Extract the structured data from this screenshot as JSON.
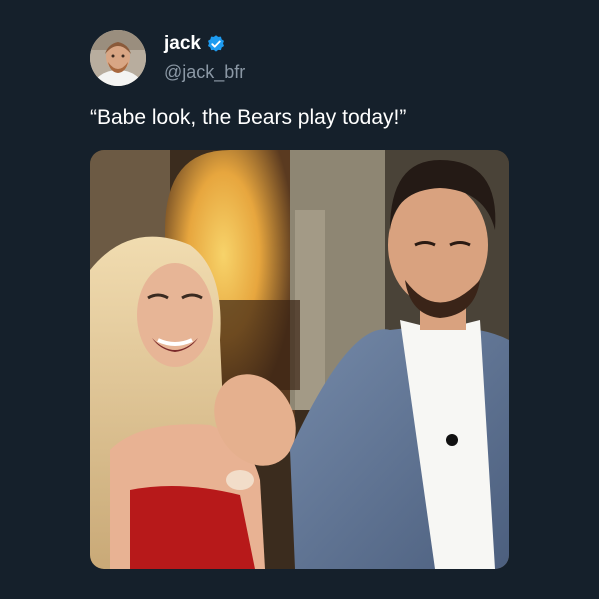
{
  "tweet": {
    "display_name": "jack",
    "handle": "@jack_bfr",
    "text": "“Babe look, the Bears play today!”",
    "verified": true,
    "verified_color": "#1d9bf0"
  },
  "colors": {
    "background": "#15202b",
    "handle_gray": "#8b98a5"
  },
  "icons": {
    "avatar": "profile-photo",
    "badge": "verified-badge-icon"
  }
}
